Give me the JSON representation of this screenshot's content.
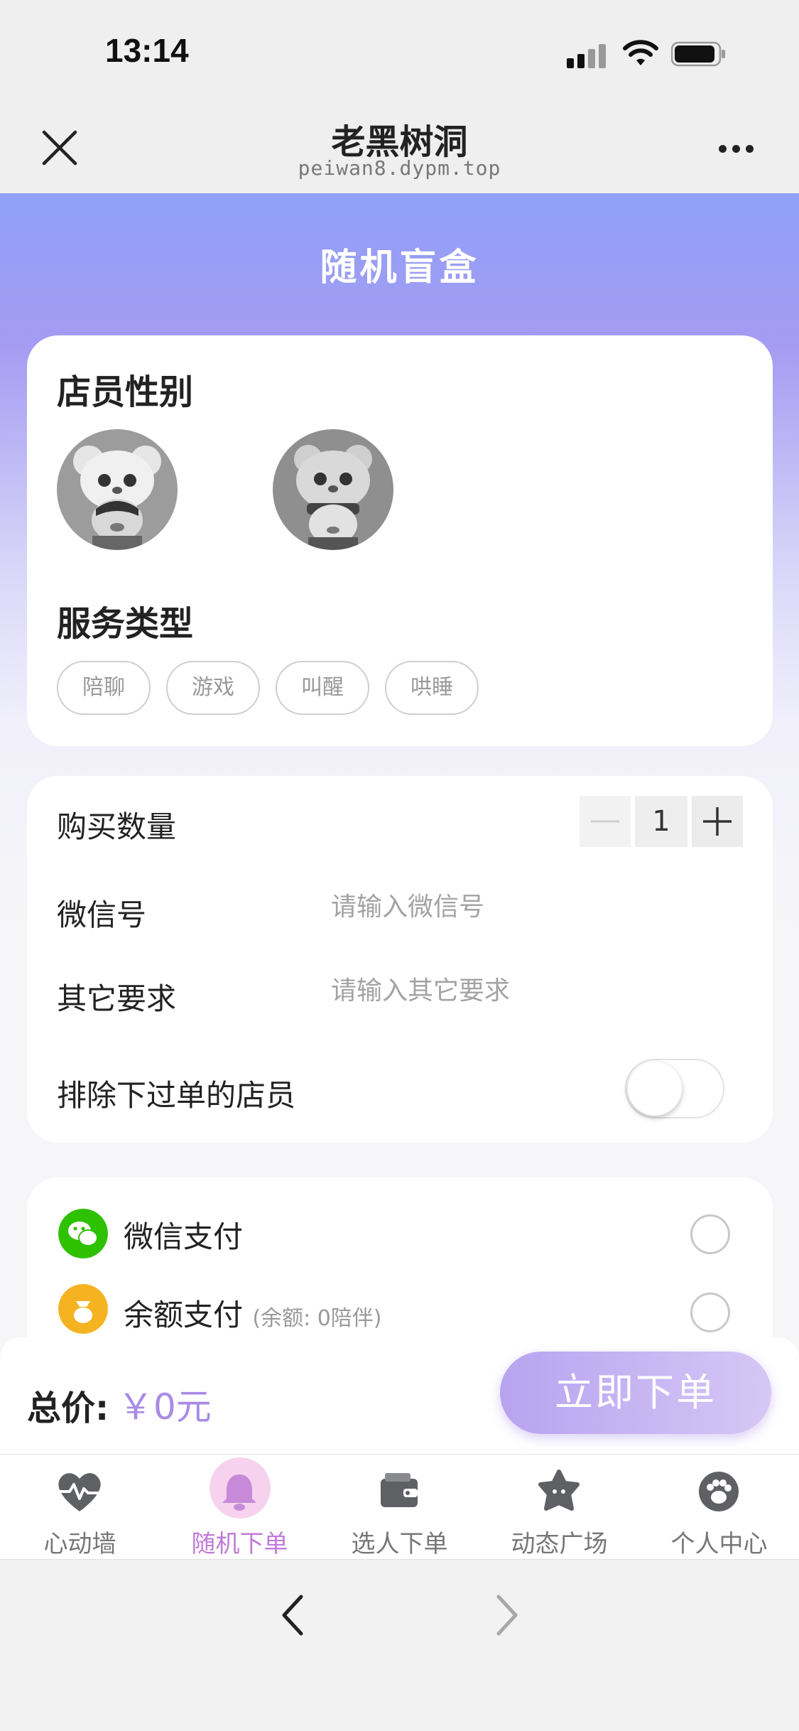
{
  "status_bar": {
    "time": "13:14"
  },
  "nav": {
    "title": "老黑树洞",
    "url": "peiwan8.dypm.top"
  },
  "page": {
    "title": "随机盲盒"
  },
  "gender": {
    "title": "店员性别"
  },
  "service": {
    "title": "服务类型",
    "tags": [
      "陪聊",
      "游戏",
      "叫醒",
      "哄睡"
    ]
  },
  "form": {
    "quantity_label": "购买数量",
    "quantity_value": "1",
    "wechat_label": "微信号",
    "wechat_placeholder": "请输入微信号",
    "other_label": "其它要求",
    "other_placeholder": "请输入其它要求",
    "exclude_label": "排除下过单的店员"
  },
  "payment": {
    "wechat_label": "微信支付",
    "balance_label": "余额支付",
    "balance_sub": "(余额: 0陪伴)"
  },
  "order": {
    "total_label": "总价:",
    "total_value": "￥0元",
    "button_label": "立即下单"
  },
  "tabs": [
    {
      "label": "心动墙"
    },
    {
      "label": "随机下单"
    },
    {
      "label": "选人下单"
    },
    {
      "label": "动态广场"
    },
    {
      "label": "个人中心"
    }
  ],
  "colors": {
    "accent": "#a88ae8",
    "active_tab": "#c07ad6",
    "wechat_green": "#2dc100",
    "balance_orange": "#f5b322"
  }
}
